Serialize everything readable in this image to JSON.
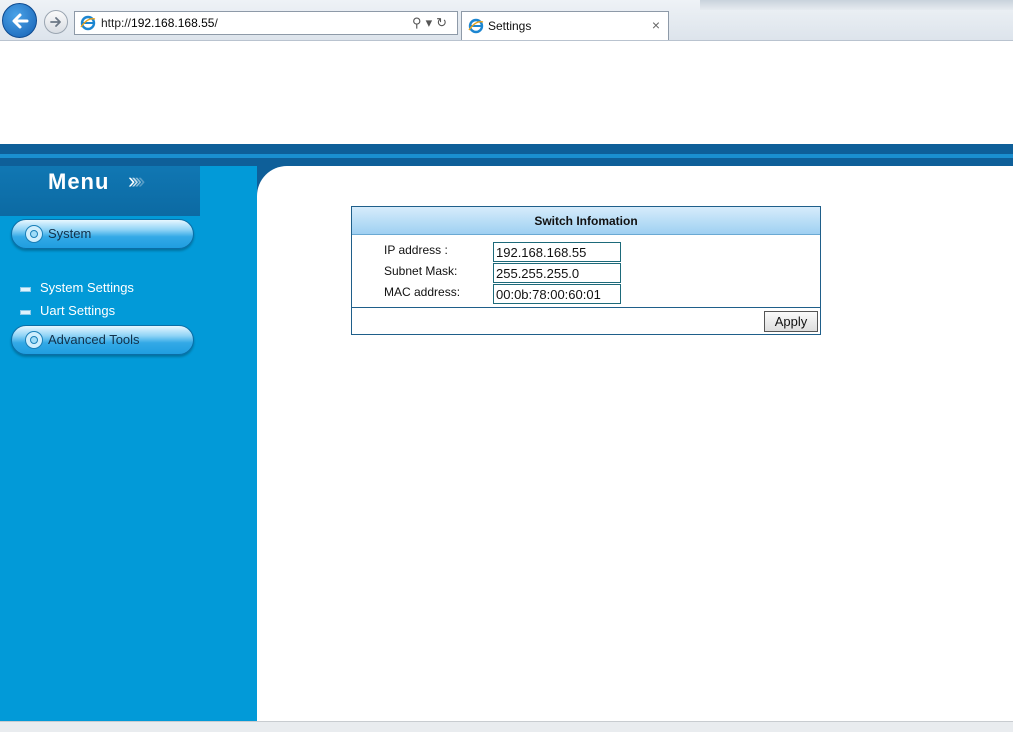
{
  "browser": {
    "address_prefix": "http://",
    "address_host": "192.168.168.55",
    "address_suffix": "/",
    "tab_title": "Settings",
    "tab_close": "×"
  },
  "sidebar": {
    "menu_title": "Menu",
    "menu_chevrons": [
      "›",
      "›",
      "›",
      "›"
    ],
    "system_label": "System",
    "items": [
      {
        "label": "System Settings"
      },
      {
        "label": "Uart Settings"
      }
    ],
    "advanced_label": "Advanced Tools"
  },
  "panel": {
    "title": "Switch Infomation",
    "rows": [
      {
        "label": "IP address :",
        "value": "192.168.168.55"
      },
      {
        "label": "Subnet Mask:",
        "value": "255.255.255.0"
      },
      {
        "label": "MAC address:",
        "value": "00:0b:78:00:60:01"
      }
    ],
    "apply_label": "Apply"
  },
  "colors": {
    "sidebar_bg": "#029ad8",
    "banner": "#0e5f99",
    "panel_header": "#9fd0f2"
  },
  "icons": [
    "back-arrow-icon",
    "forward-arrow-icon",
    "ie-page-icon",
    "search-icon",
    "refresh-icon",
    "close-icon",
    "radio-ring-icon"
  ]
}
